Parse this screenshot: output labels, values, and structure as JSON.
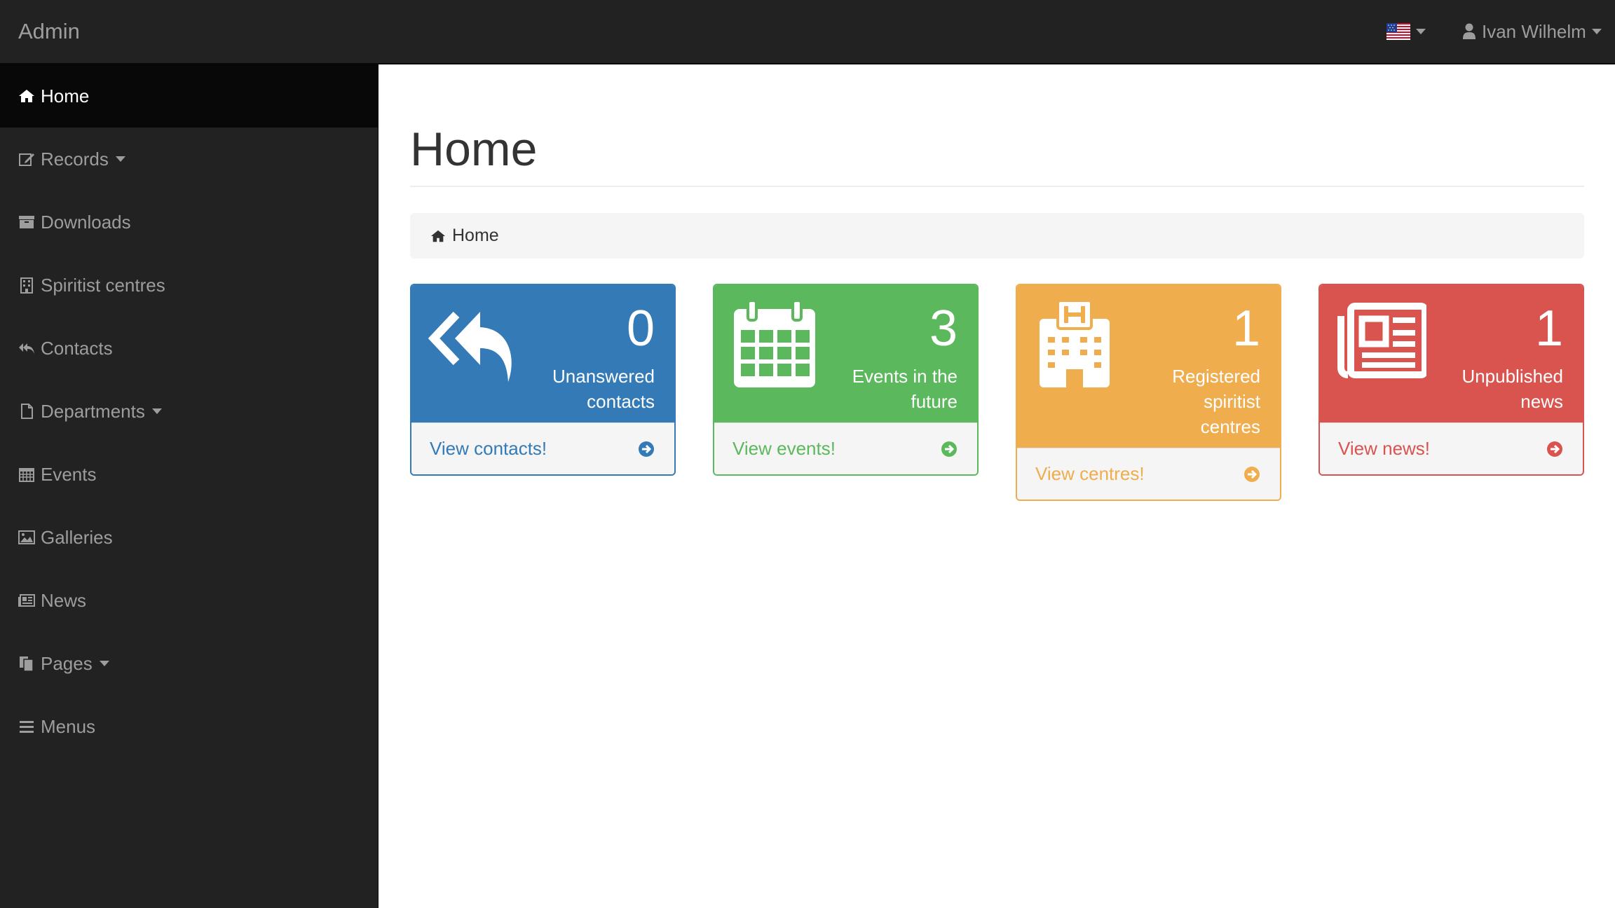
{
  "navbar": {
    "brand": "Admin",
    "language_icon": "us-flag-icon",
    "user_name": "Ivan Wilhelm"
  },
  "sidebar": {
    "items": [
      {
        "label": "Home",
        "icon": "home-icon",
        "active": true
      },
      {
        "label": "Records",
        "icon": "edit-icon",
        "dropdown": true
      },
      {
        "label": "Downloads",
        "icon": "archive-icon"
      },
      {
        "label": "Spiritist centres",
        "icon": "building-icon"
      },
      {
        "label": "Contacts",
        "icon": "reply-all-icon"
      },
      {
        "label": "Departments",
        "icon": "file-icon",
        "dropdown": true
      },
      {
        "label": "Events",
        "icon": "calendar-icon"
      },
      {
        "label": "Galleries",
        "icon": "image-icon"
      },
      {
        "label": "News",
        "icon": "newspaper-icon"
      },
      {
        "label": "Pages",
        "icon": "files-icon",
        "dropdown": true
      },
      {
        "label": "Menus",
        "icon": "bars-icon"
      }
    ]
  },
  "main": {
    "title": "Home",
    "breadcrumb": "Home"
  },
  "panels": [
    {
      "count": "0",
      "label_lines": [
        "Unanswered",
        "contacts"
      ],
      "link": "View contacts!",
      "color": "#337ab7",
      "icon": "reply-all-icon"
    },
    {
      "count": "3",
      "label_lines": [
        "Events in the",
        "future"
      ],
      "link": "View events!",
      "color": "#5cb85c",
      "icon": "calendar-icon"
    },
    {
      "count": "1",
      "label_lines": [
        "Registered",
        "spiritist",
        "centres"
      ],
      "link": "View centres!",
      "color": "#f0ad4e",
      "icon": "hospital-building-icon"
    },
    {
      "count": "1",
      "label_lines": [
        "Unpublished",
        "news"
      ],
      "link": "View news!",
      "color": "#d9534f",
      "icon": "newspaper-icon"
    }
  ],
  "colors": {
    "navbar_bg": "#222222",
    "sidebar_active_bg": "#080808",
    "sidebar_text": "#9d9d9d"
  }
}
